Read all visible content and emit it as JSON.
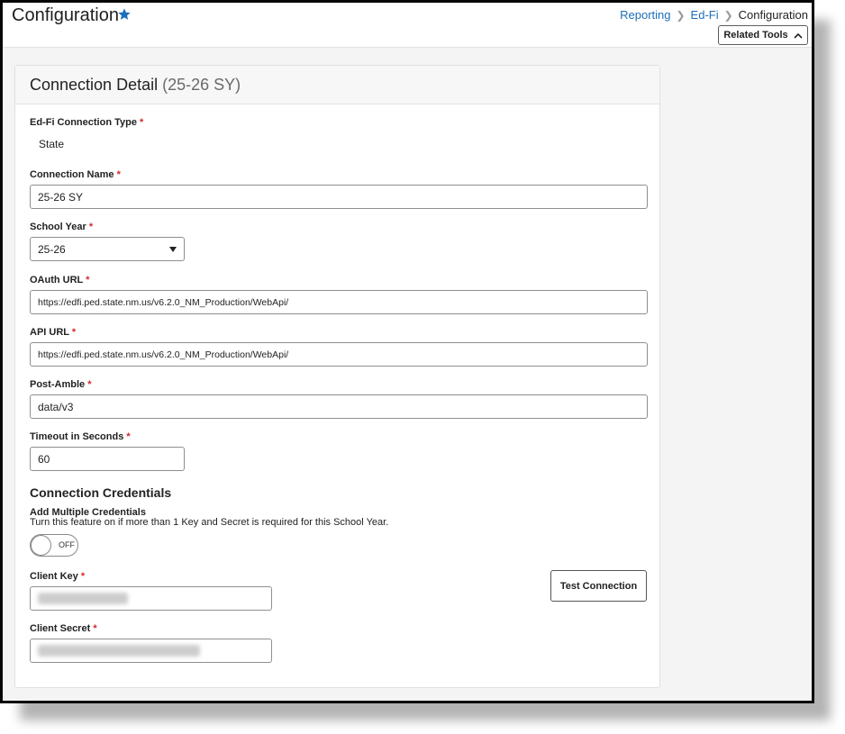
{
  "header": {
    "title": "Configuration",
    "breadcrumb": [
      "Reporting",
      "Ed-Fi",
      "Configuration"
    ],
    "related_tools_label": "Related Tools"
  },
  "card": {
    "title": "Connection Detail",
    "school_year_tag": "(25-26 SY)"
  },
  "form": {
    "connection_type": {
      "label": "Ed-Fi Connection Type",
      "value": "State"
    },
    "connection_name": {
      "label": "Connection Name",
      "value": "25-26 SY"
    },
    "school_year": {
      "label": "School Year",
      "value": "25-26"
    },
    "oauth_url": {
      "label": "OAuth URL",
      "value": "https://edfi.ped.state.nm.us/v6.2.0_NM_Production/WebApi/"
    },
    "api_url": {
      "label": "API URL",
      "value": "https://edfi.ped.state.nm.us/v6.2.0_NM_Production/WebApi/"
    },
    "post_amble": {
      "label": "Post-Amble",
      "value": "data/v3"
    },
    "timeout": {
      "label": "Timeout in Seconds",
      "value": "60"
    },
    "required_mark": "*"
  },
  "credentials": {
    "section_title": "Connection Credentials",
    "multi_label": "Add Multiple Credentials",
    "multi_help": "Turn this feature on if more than 1 Key and Secret is required for this School Year.",
    "toggle_state": "OFF",
    "client_key_label": "Client Key",
    "client_secret_label": "Client Secret",
    "test_button_label": "Test Connection"
  },
  "colors": {
    "link": "#1d6fb8",
    "star": "#1d6fb8",
    "required": "#d6262b"
  },
  "icons": {
    "favorite": "star-icon",
    "separator": "chevron-right-icon",
    "related_tools": "chevron-up-icon",
    "select": "caret-down-icon"
  }
}
